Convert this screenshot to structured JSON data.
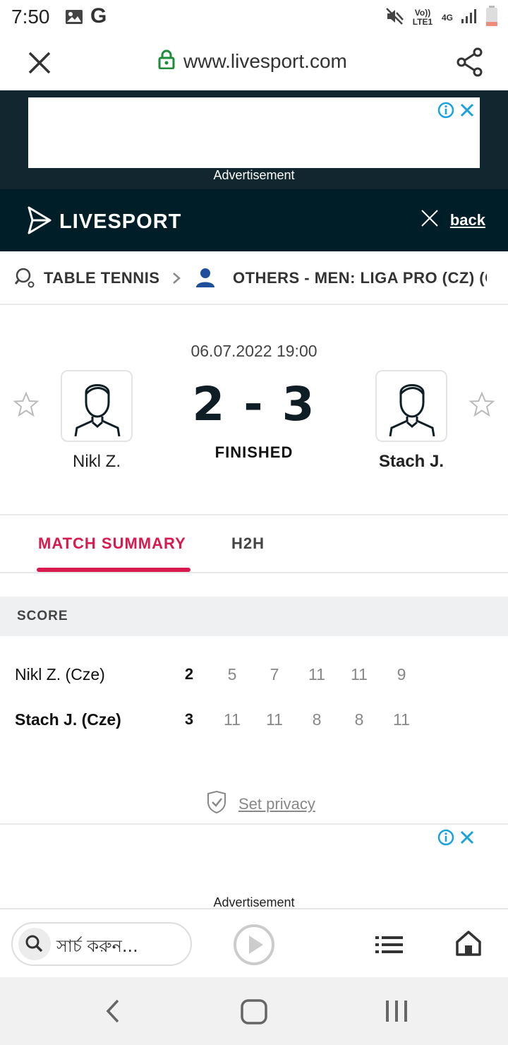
{
  "status_bar": {
    "time": "7:50",
    "google_icon_letter": "G",
    "network_text": "Vo)) LTE1",
    "network_type": "4G",
    "icons": [
      "gallery-icon",
      "mute-icon",
      "signal-icon",
      "battery-icon"
    ]
  },
  "browser": {
    "url": "www.livesport.com",
    "icons": [
      "close-icon",
      "lock-icon",
      "share-icon"
    ]
  },
  "ads": {
    "label": "Advertisement"
  },
  "site_header": {
    "logo_text": "LIVESPORT",
    "back_label": "back"
  },
  "breadcrumb": {
    "sport": "TABLE TENNIS",
    "league": "OTHERS - MEN: LIGA PRO (CZ) (C"
  },
  "match": {
    "date": "06.07.2022 19:00",
    "home": "Nikl Z.",
    "away": "Stach J.",
    "score": "2 - 3",
    "status": "FINISHED"
  },
  "tabs": [
    {
      "label": "MATCH SUMMARY",
      "active": true
    },
    {
      "label": "H2H",
      "active": false
    }
  ],
  "score_table": {
    "heading": "SCORE",
    "rows": [
      {
        "name": "Nikl Z. (Cze)",
        "total": "2",
        "sets": [
          "5",
          "7",
          "11",
          "11",
          "9"
        ]
      },
      {
        "name": "Stach J. (Cze)",
        "total": "3",
        "sets": [
          "11",
          "11",
          "8",
          "8",
          "11"
        ]
      }
    ]
  },
  "privacy": {
    "label": "Set privacy"
  },
  "bottom_bar": {
    "search_placeholder": "সার্চ করুন..."
  },
  "colors": {
    "accent": "#d91a4e",
    "header_bg": "#001e28",
    "ad_bg": "#11262e",
    "info_icon": "#1aa3d9"
  }
}
